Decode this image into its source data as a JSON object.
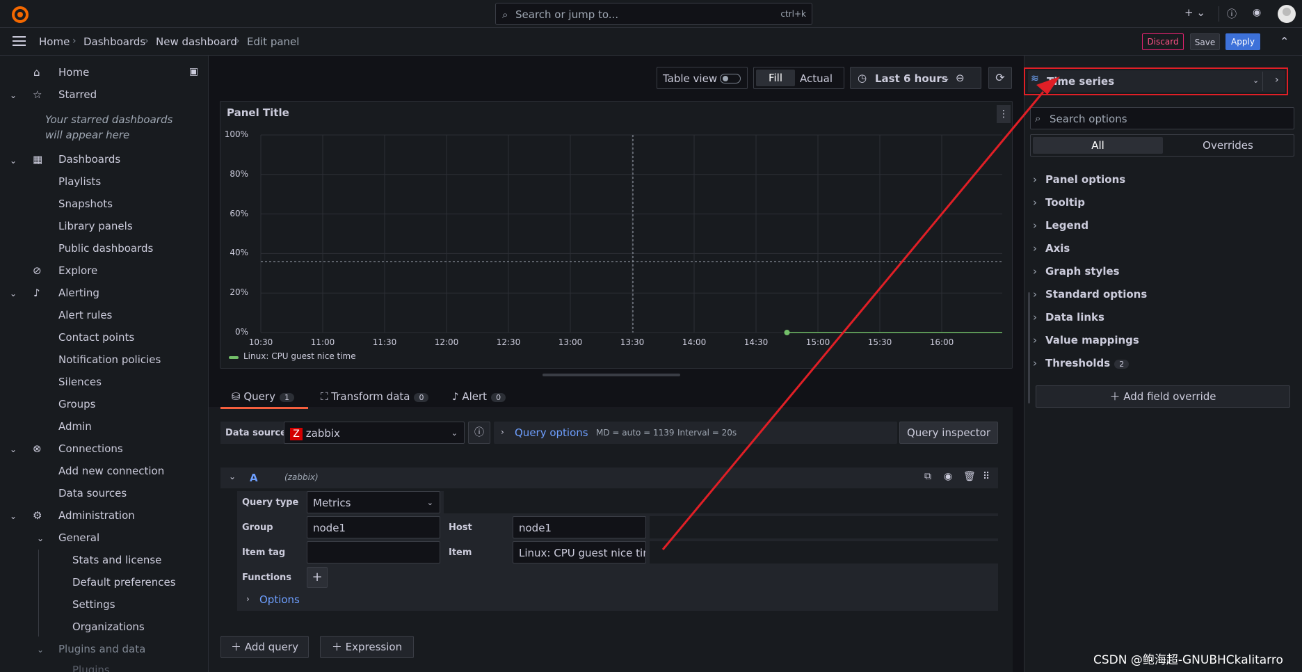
{
  "topbar": {
    "search_placeholder": "Search or jump to...",
    "shortcut": "ctrl+k"
  },
  "breadcrumb": [
    "Home",
    "Dashboards",
    "New dashboard",
    "Edit panel"
  ],
  "actions": {
    "discard": "Discard",
    "save": "Save",
    "apply": "Apply"
  },
  "sidebar": {
    "home": "Home",
    "starred": "Starred",
    "starred_empty": "Your starred dashboards will appear here",
    "dashboards": "Dashboards",
    "playlists": "Playlists",
    "snapshots": "Snapshots",
    "library_panels": "Library panels",
    "public_dashboards": "Public dashboards",
    "explore": "Explore",
    "alerting": "Alerting",
    "alert_rules": "Alert rules",
    "contact_points": "Contact points",
    "notification_policies": "Notification policies",
    "silences": "Silences",
    "groups": "Groups",
    "admin": "Admin",
    "connections": "Connections",
    "add_new_connection": "Add new connection",
    "data_sources": "Data sources",
    "administration": "Administration",
    "general": "General",
    "stats_license": "Stats and license",
    "default_preferences": "Default preferences",
    "settings": "Settings",
    "organizations": "Organizations",
    "plugins_data": "Plugins and data",
    "cut_item": "Plugins"
  },
  "toolbar": {
    "table_view": "Table view",
    "fill": "Fill",
    "actual": "Actual",
    "time_range": "Last 6 hours"
  },
  "panel": {
    "title": "Panel Title",
    "legend": "Linux: CPU guest nice time"
  },
  "chart_data": {
    "type": "line",
    "y_ticks": [
      "100%",
      "80%",
      "60%",
      "40%",
      "20%",
      "0%"
    ],
    "x_ticks": [
      "10:30",
      "11:00",
      "11:30",
      "12:00",
      "12:30",
      "13:00",
      "13:30",
      "14:00",
      "14:30",
      "15:00",
      "15:30",
      "16:00"
    ],
    "ylim": [
      0,
      100
    ],
    "series": [
      {
        "name": "Linux: CPU guest nice time",
        "x": [
          "14:45",
          "16:50"
        ],
        "y": [
          0,
          0
        ],
        "color": "#73bf69"
      }
    ]
  },
  "query_tabs": [
    {
      "label": "Query",
      "count": "1"
    },
    {
      "label": "Transform data",
      "count": "0"
    },
    {
      "label": "Alert",
      "count": "0"
    }
  ],
  "query": {
    "data_source_label": "Data source",
    "data_source": "zabbix",
    "query_options": "Query options",
    "md": "MD = auto = 1139",
    "interval": "Interval = 20s",
    "inspector": "Query inspector",
    "ref": "A",
    "ref_ds": "(zabbix)",
    "query_type_label": "Query type",
    "query_type": "Metrics",
    "group_label": "Group",
    "group": "node1",
    "host_label": "Host",
    "host": "node1",
    "item_tag_label": "Item tag",
    "item_tag": "",
    "item_label": "Item",
    "item": "Linux: CPU guest nice time",
    "functions_label": "Functions",
    "options_label": "Options"
  },
  "buttons": {
    "add_query": "Add query",
    "expression": "Expression"
  },
  "right": {
    "viz": "Time series",
    "search_options": "Search options",
    "all": "All",
    "overrides": "Overrides",
    "options": [
      "Panel options",
      "Tooltip",
      "Legend",
      "Axis",
      "Graph styles",
      "Standard options",
      "Data links",
      "Value mappings",
      "Thresholds"
    ],
    "thresholds_count": "2",
    "add_override": "Add field override"
  },
  "watermark": "CSDN @鲍海超-GNUBHCkalitarro"
}
